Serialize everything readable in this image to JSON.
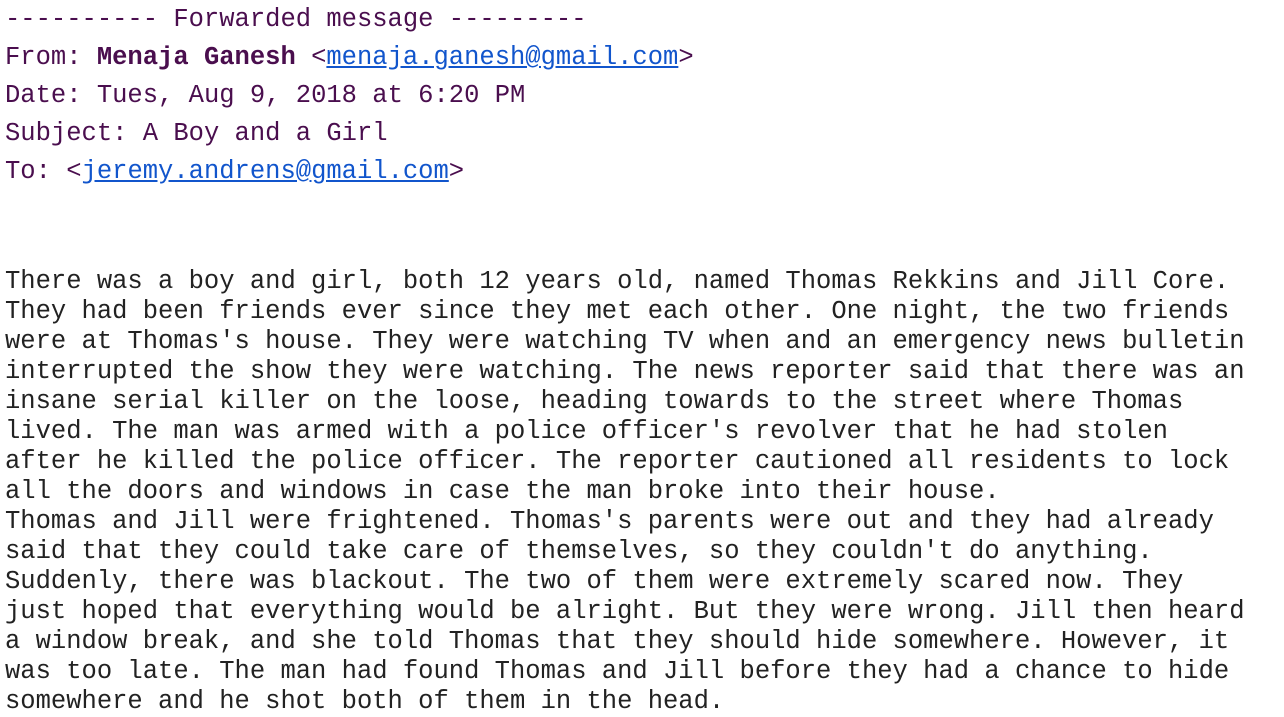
{
  "forwarded_header": {
    "separator_line": "---------- Forwarded message ---------",
    "from_label": "From: ",
    "from_name": "Menaja Ganesh",
    "from_email_open": " <",
    "from_email": "menaja.ganesh@gmail.com",
    "from_email_close": ">",
    "date_label": "Date: ",
    "date_value": "Tues, Aug 9, 2018 at 6:20 PM",
    "subject_label": "Subject: ",
    "subject_value": "A Boy and a Girl",
    "to_label": "To: ",
    "to_email_open": "<",
    "to_email": "jeremy.andrens@gmail.com",
    "to_email_close": ">"
  },
  "message_body": {
    "lines": [
      "There was a boy and girl, both 12 years old, named Thomas Rekkins and Jill Core.",
      "They had been friends ever since they met each other. One night, the two friends",
      "were at Thomas's house. They were watching TV when and an emergency news bulletin",
      "interrupted the show they were watching. The news reporter said that there was an",
      "insane serial killer on the loose, heading towards to the street where Thomas",
      "lived. The man was armed with a police officer's revolver that he had stolen",
      "after he killed the police officer. The reporter cautioned all residents to lock",
      "all the doors and windows in case the man broke into their house.",
      "Thomas and Jill were frightened. Thomas's parents were out and they had already",
      "said that they could take care of themselves, so they couldn't do anything.",
      "Suddenly, there was blackout. The two of them were extremely scared now. They",
      "just hoped that everything would be alright. But they were wrong. Jill then heard",
      "a window break, and she told Thomas that they should hide somewhere. However, it",
      "was too late. The man had found Thomas and Jill before they had a chance to hide",
      "somewhere and he shot both of them in the head."
    ]
  }
}
